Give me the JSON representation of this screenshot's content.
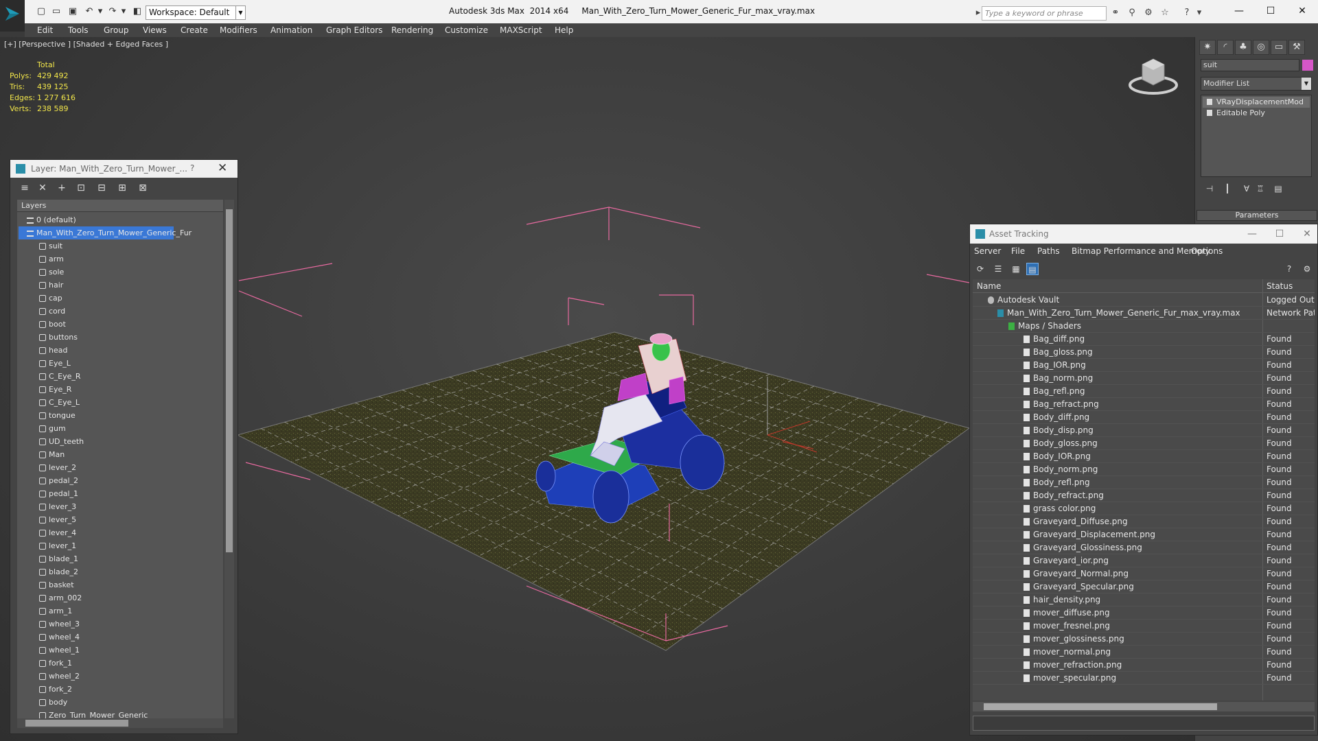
{
  "titlebar": {
    "workspace": "Workspace: Default",
    "title": "Autodesk 3ds Max  2014 x64     Man_With_Zero_Turn_Mower_Generic_Fur_max_vray.max",
    "search_placeholder": "Type a keyword or phrase"
  },
  "menu": [
    "Edit",
    "Tools",
    "Group",
    "Views",
    "Create",
    "Modifiers",
    "Animation",
    "Graph Editors",
    "Rendering",
    "Customize",
    "MAXScript",
    "Help"
  ],
  "viewport": {
    "label": "[+] [Perspective ] [Shaded + Edged Faces ]",
    "stats": {
      "header": "Total",
      "rows": [
        {
          "label": "Polys:",
          "value": "429 492"
        },
        {
          "label": "Tris:",
          "value": "439 125"
        },
        {
          "label": "Edges:",
          "value": "1 277 616"
        },
        {
          "label": "Verts:",
          "value": "238 589"
        }
      ]
    }
  },
  "layer_panel": {
    "title": "Layer: Man_With_Zero_Turn_Mower_...",
    "help": "?",
    "header": "Layers",
    "default_layer": "0 (default)",
    "active_layer": "Man_With_Zero_Turn_Mower_Generic_Fur",
    "objects": [
      "suit",
      "arm",
      "sole",
      "hair",
      "cap",
      "cord",
      "boot",
      "buttons",
      "head",
      "Eye_L",
      "C_Eye_R",
      "Eye_R",
      "C_Eye_L",
      "tongue",
      "gum",
      "UD_teeth",
      "Man",
      "lever_2",
      "pedal_2",
      "pedal_1",
      "lever_3",
      "lever_5",
      "lever_4",
      "lever_1",
      "blade_1",
      "blade_2",
      "basket",
      "arm_002",
      "arm_1",
      "wheel_3",
      "wheel_4",
      "wheel_1",
      "fork_1",
      "wheel_2",
      "fork_2",
      "body",
      "Zero_Turn_Mower_Generic"
    ]
  },
  "command_panel": {
    "object_name": "suit",
    "object_color": "#d657c7",
    "modifier_list": "Modifier List",
    "stack": [
      "VRayDisplacementMod",
      "Editable Poly"
    ],
    "rollout": "Parameters"
  },
  "asset_tracking": {
    "title": "Asset Tracking",
    "menu": [
      "Server",
      "File",
      "Paths",
      "Bitmap Performance and Memory",
      "Options"
    ],
    "columns": {
      "name": "Name",
      "status": "Status"
    },
    "vault": {
      "name": "Autodesk Vault",
      "status": "Logged Out ..."
    },
    "scene": {
      "name": "Man_With_Zero_Turn_Mower_Generic_Fur_max_vray.max",
      "status": "Network Path"
    },
    "maps_group": "Maps / Shaders",
    "files": [
      {
        "name": "Bag_diff.png",
        "status": "Found"
      },
      {
        "name": "Bag_gloss.png",
        "status": "Found"
      },
      {
        "name": "Bag_IOR.png",
        "status": "Found"
      },
      {
        "name": "Bag_norm.png",
        "status": "Found"
      },
      {
        "name": "Bag_refl.png",
        "status": "Found"
      },
      {
        "name": "Bag_refract.png",
        "status": "Found"
      },
      {
        "name": "Body_diff.png",
        "status": "Found"
      },
      {
        "name": "Body_disp.png",
        "status": "Found"
      },
      {
        "name": "Body_gloss.png",
        "status": "Found"
      },
      {
        "name": "Body_IOR.png",
        "status": "Found"
      },
      {
        "name": "Body_norm.png",
        "status": "Found"
      },
      {
        "name": "Body_refl.png",
        "status": "Found"
      },
      {
        "name": "Body_refract.png",
        "status": "Found"
      },
      {
        "name": "grass color.png",
        "status": "Found"
      },
      {
        "name": "Graveyard_Diffuse.png",
        "status": "Found"
      },
      {
        "name": "Graveyard_Displacement.png",
        "status": "Found"
      },
      {
        "name": "Graveyard_Glossiness.png",
        "status": "Found"
      },
      {
        "name": "Graveyard_ior.png",
        "status": "Found"
      },
      {
        "name": "Graveyard_Normal.png",
        "status": "Found"
      },
      {
        "name": "Graveyard_Specular.png",
        "status": "Found"
      },
      {
        "name": "hair_density.png",
        "status": "Found"
      },
      {
        "name": "mover_diffuse.png",
        "status": "Found"
      },
      {
        "name": "mover_fresnel.png",
        "status": "Found"
      },
      {
        "name": "mover_glossiness.png",
        "status": "Found"
      },
      {
        "name": "mover_normal.png",
        "status": "Found"
      },
      {
        "name": "mover_refraction.png",
        "status": "Found"
      },
      {
        "name": "mover_specular.png",
        "status": "Found"
      }
    ]
  },
  "colors": {
    "accent": "#3a78d6",
    "stats": "#f2e64a",
    "bounding": "#e86aa0"
  }
}
